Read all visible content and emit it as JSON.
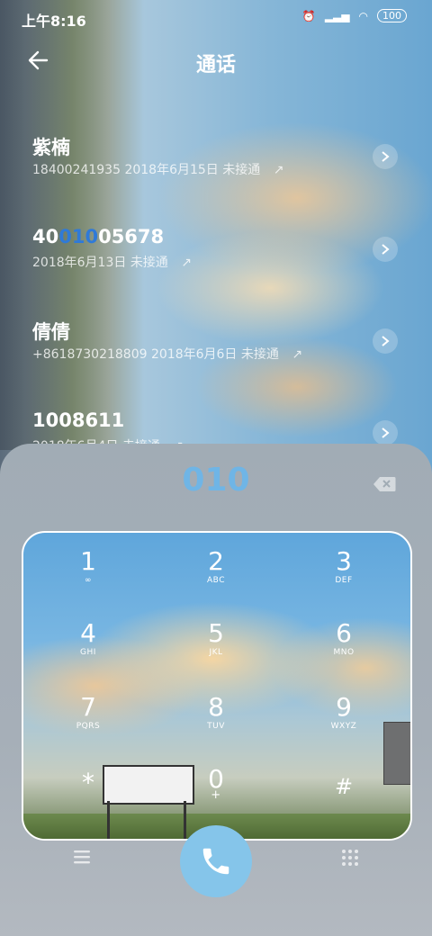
{
  "status_bar": {
    "time": "上午8:16",
    "battery": "100"
  },
  "header": {
    "title": "通话"
  },
  "calls": [
    {
      "name": "紫楠",
      "name_highlight": "",
      "name_rest": "",
      "number": "18400241935",
      "date": "2018年6月15日",
      "status": "未接通"
    },
    {
      "name": "40",
      "name_highlight": "010",
      "name_rest": "05678",
      "number": "",
      "date": "2018年6月13日",
      "status": "未接通"
    },
    {
      "name": "倩倩",
      "name_highlight": "",
      "name_rest": "",
      "number": "+8618730218809",
      "date": "2018年6月6日",
      "status": "未接通"
    },
    {
      "name": "1008611",
      "name_highlight": "",
      "name_rest": "",
      "number": "",
      "date": "2018年6月4日",
      "status": "未接通"
    }
  ],
  "dialer": {
    "input": "010",
    "keys": [
      {
        "digit": "1",
        "letters": "∞"
      },
      {
        "digit": "2",
        "letters": "ABC"
      },
      {
        "digit": "3",
        "letters": "DEF"
      },
      {
        "digit": "4",
        "letters": "GHI"
      },
      {
        "digit": "5",
        "letters": "JKL"
      },
      {
        "digit": "6",
        "letters": "MNO"
      },
      {
        "digit": "7",
        "letters": "PQRS"
      },
      {
        "digit": "8",
        "letters": "TUV"
      },
      {
        "digit": "9",
        "letters": "WXYZ"
      },
      {
        "digit": "*",
        "letters": ""
      },
      {
        "digit": "0",
        "letters": "+"
      },
      {
        "digit": "#",
        "letters": ""
      }
    ]
  },
  "icons": {
    "back": "arrow-left-icon",
    "detail": "chevron-right-icon",
    "backspace": "backspace-icon",
    "menu": "menu-icon",
    "call": "phone-icon",
    "keypad_toggle": "dialpad-icon"
  },
  "colors": {
    "accent": "#6fb5e6",
    "call_button": "#85c5ea",
    "highlight": "#2f7ad8"
  }
}
